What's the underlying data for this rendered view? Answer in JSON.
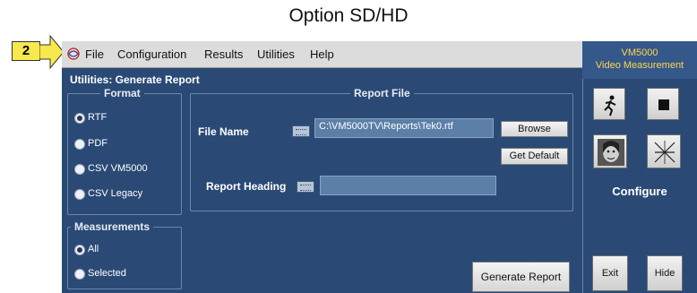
{
  "caption": "Option SD/HD",
  "callout": "2",
  "menu": [
    "File",
    "Configuration",
    "Results",
    "Utilities",
    "Help"
  ],
  "window_title": "Utilities: Generate Report",
  "format": {
    "legend": "Format",
    "options": [
      "RTF",
      "PDF",
      "CSV VM5000",
      "CSV Legacy"
    ],
    "selected": "RTF"
  },
  "report_file": {
    "legend": "Report File",
    "file_name_label": "File Name",
    "file_name_value": "C:\\VM5000TV\\Reports\\Tek0.rtf",
    "browse": "Browse",
    "get_default": "Get Default",
    "heading_label": "Report Heading",
    "heading_value": ""
  },
  "measurements": {
    "legend": "Measurements",
    "options": [
      "All",
      "Selected"
    ],
    "selected": "All"
  },
  "generate_report": "Generate Report",
  "right_panel": {
    "line1": "VM5000",
    "line2": "Video Measurement",
    "configure": "Configure",
    "exit": "Exit",
    "hide": "Hide"
  }
}
